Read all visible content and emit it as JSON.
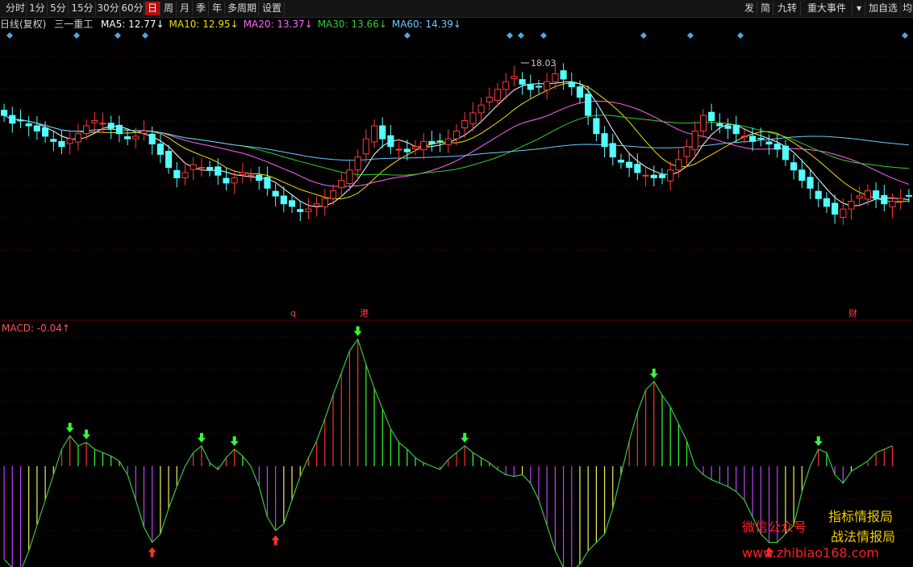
{
  "toolbar": {
    "left": [
      "分时",
      "1分",
      "5分",
      "15分",
      "30分",
      "60分",
      "日",
      "周",
      "月",
      "季",
      "年",
      "多周期",
      "设置"
    ],
    "active": "日",
    "right": [
      "发",
      "简",
      "九转",
      "重大事件",
      "▾",
      "加自选",
      "均线"
    ]
  },
  "header": {
    "period": "日线(复权)",
    "name": "三一重工",
    "ma": [
      {
        "label": "MA5: 12.77↓",
        "color": "#ffffff"
      },
      {
        "label": "MA10: 12.95↓",
        "color": "#f0e000"
      },
      {
        "label": "MA20: 13.37↓",
        "color": "#ff66ff"
      },
      {
        "label": "MA30: 13.66↓",
        "color": "#33cc33"
      },
      {
        "label": "MA60: 14.39↓",
        "color": "#66ccff"
      }
    ]
  },
  "colors": {
    "up": "#ff3a3a",
    "down": "#54ffff",
    "bg": "#000000",
    "grid": "#3a0000",
    "macd_line": "#3ac83a"
  },
  "price_markers": {
    "max_label": "18.03",
    "q_label": "q",
    "gang_label": "港",
    "cai_label": "财"
  },
  "macd": {
    "label": "MACD: -0.04↑"
  },
  "watermark": {
    "a": "微信公众号",
    "b": "指标情报局",
    "c": "战法情报局",
    "d": "www.zhibiao168.com"
  },
  "chart_data": {
    "type": "candlestick",
    "ylim": [
      10,
      19
    ],
    "max_price": 18.03,
    "closes": [
      15.8,
      15.5,
      15.6,
      15.4,
      15.2,
      15.0,
      14.8,
      14.6,
      14.9,
      15.1,
      15.4,
      15.6,
      15.5,
      15.3,
      15.1,
      14.9,
      15.0,
      15.2,
      14.7,
      14.3,
      13.8,
      13.4,
      13.6,
      13.9,
      13.8,
      13.7,
      13.5,
      13.2,
      13.4,
      13.6,
      13.5,
      13.3,
      13.0,
      12.7,
      12.4,
      12.3,
      12.1,
      12.2,
      12.4,
      12.6,
      12.9,
      13.3,
      13.7,
      14.2,
      14.9,
      15.4,
      14.9,
      14.6,
      14.5,
      14.4,
      14.6,
      14.8,
      14.7,
      14.8,
      14.9,
      15.2,
      15.6,
      15.9,
      16.2,
      16.5,
      16.8,
      17.1,
      17.3,
      17.0,
      16.8,
      16.9,
      17.1,
      17.4,
      17.2,
      16.9,
      16.5,
      15.8,
      15.1,
      14.6,
      14.2,
      14.0,
      13.8,
      13.6,
      13.5,
      13.4,
      13.4,
      13.7,
      14.1,
      14.6,
      15.2,
      15.8,
      15.6,
      15.4,
      15.3,
      15.1,
      15.0,
      14.8,
      14.9,
      14.7,
      14.5,
      14.1,
      13.7,
      13.3,
      13.0,
      12.6,
      12.3,
      12.0,
      12.2,
      12.5,
      12.7,
      12.9,
      12.6,
      12.4,
      12.5,
      12.6,
      12.7
    ],
    "macd": [
      -0.55,
      -0.6,
      -0.62,
      -0.5,
      -0.35,
      -0.2,
      -0.05,
      0.1,
      0.18,
      0.12,
      0.14,
      0.1,
      0.08,
      0.06,
      0.03,
      -0.05,
      -0.2,
      -0.36,
      -0.45,
      -0.4,
      -0.25,
      -0.12,
      0.0,
      0.08,
      0.12,
      0.02,
      -0.02,
      0.05,
      0.1,
      0.06,
      0.0,
      -0.12,
      -0.3,
      -0.38,
      -0.34,
      -0.2,
      -0.06,
      0.05,
      0.15,
      0.28,
      0.42,
      0.55,
      0.68,
      0.75,
      0.6,
      0.46,
      0.34,
      0.22,
      0.14,
      0.1,
      0.05,
      0.02,
      0.0,
      -0.02,
      0.04,
      0.08,
      0.12,
      0.08,
      0.05,
      0.02,
      -0.02,
      -0.05,
      -0.06,
      -0.05,
      -0.1,
      -0.2,
      -0.35,
      -0.5,
      -0.6,
      -0.62,
      -0.58,
      -0.5,
      -0.45,
      -0.4,
      -0.25,
      -0.05,
      0.15,
      0.32,
      0.45,
      0.5,
      0.42,
      0.35,
      0.25,
      0.15,
      0.0,
      -0.05,
      -0.08,
      -0.1,
      -0.12,
      -0.15,
      -0.2,
      -0.3,
      -0.4,
      -0.45,
      -0.45,
      -0.4,
      -0.35,
      -0.15,
      0.0,
      0.1,
      0.08,
      -0.05,
      -0.1,
      -0.03,
      0.0,
      0.03,
      0.08,
      0.1,
      0.12
    ]
  }
}
